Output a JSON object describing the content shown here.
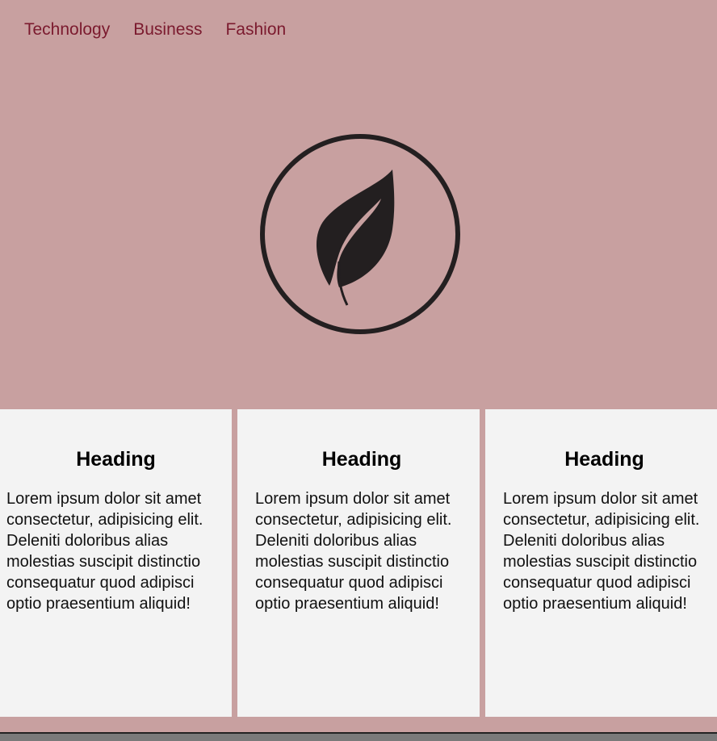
{
  "nav": {
    "items": [
      {
        "label": "Technology"
      },
      {
        "label": "Business"
      },
      {
        "label": "Fashion"
      }
    ]
  },
  "logo": {
    "icon": "leaf-icon"
  },
  "cards": [
    {
      "heading": "Heading",
      "body": "Lorem ipsum dolor sit amet consectetur, adipisicing elit. Deleniti doloribus alias molestias suscipit distinctio consequatur quod adipisci optio praesentium aliquid!"
    },
    {
      "heading": "Heading",
      "body": "Lorem ipsum dolor sit amet consectetur, adipisicing elit. Deleniti doloribus alias molestias suscipit distinctio consequatur quod adipisci optio praesentium aliquid!"
    },
    {
      "heading": "Heading",
      "body": "Lorem ipsum dolor sit amet consectetur, adipisicing elit. Deleniti doloribus alias molestias suscipit distinctio consequatur quod adipisci optio praesentium aliquid!"
    }
  ],
  "colors": {
    "background": "#c8a0a0",
    "nav_link": "#7b1a2e",
    "card_bg": "#f3f3f3",
    "logo": "#231f20"
  }
}
